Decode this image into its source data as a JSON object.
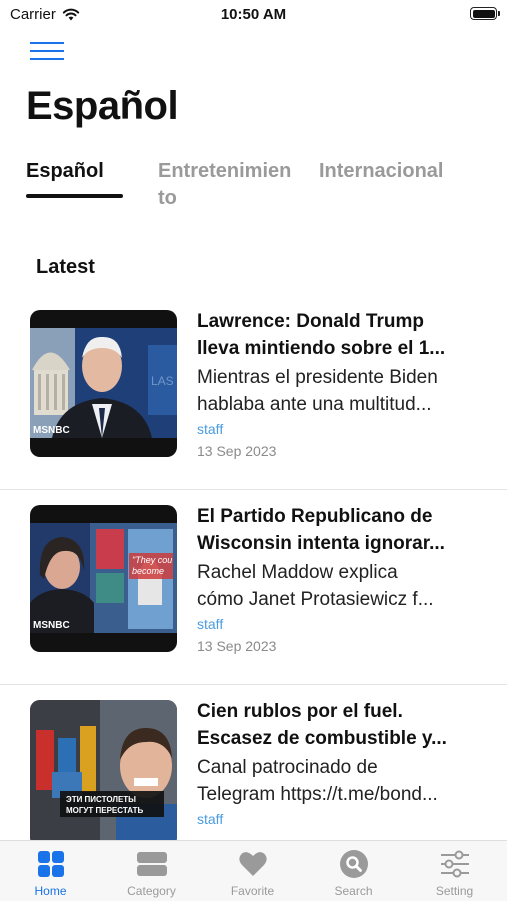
{
  "status_bar": {
    "carrier": "Carrier",
    "time": "10:50 AM"
  },
  "header": {
    "title": "Español"
  },
  "tabs": [
    {
      "label": "Español",
      "active": true
    },
    {
      "label": "Entretenimien",
      "label2": "to",
      "active": false
    },
    {
      "label": "Internacional",
      "active": false
    }
  ],
  "section": {
    "label": "Latest"
  },
  "articles": [
    {
      "title1": "Lawrence: Donald Trump",
      "title2": "lleva mintiendo sobre el 1...",
      "desc1": "Mientras el presidente Biden",
      "desc2": "hablaba ante una multitud...",
      "author": "staff",
      "date": "13 Sep 2023",
      "thumb_badge": "MSNBC"
    },
    {
      "title1": "El Partido Republicano de",
      "title2": "Wisconsin intenta ignorar...",
      "desc1": "Rachel Maddow explica",
      "desc2": "cómo Janet Protasiewicz f...",
      "author": "staff",
      "date": "13 Sep 2023",
      "thumb_badge": "MSNBC"
    },
    {
      "title1": "Cien rublos por el fuel.",
      "title2": "Escasez de combustible y...",
      "desc1": "Canal patrocinado de",
      "desc2": "Telegram https://t.me/bond...",
      "author": "staff",
      "date": "",
      "thumb_badge": "ЭТИ ПИСТОЛЕТЫ МОГУТ ПЕРЕСТАТЬ СТРЕЛЯТЬ"
    }
  ],
  "tabbar": {
    "items": [
      {
        "label": "Home",
        "icon": "grid-icon",
        "active": true
      },
      {
        "label": "Category",
        "icon": "category-icon",
        "active": false
      },
      {
        "label": "Favorite",
        "icon": "heart-icon",
        "active": false
      },
      {
        "label": "Search",
        "icon": "search-icon",
        "active": false
      },
      {
        "label": "Setting",
        "icon": "sliders-icon",
        "active": false
      }
    ]
  },
  "colors": {
    "accent": "#1a73e8",
    "link": "#4a9be0",
    "inactive": "#9a9a9a"
  }
}
